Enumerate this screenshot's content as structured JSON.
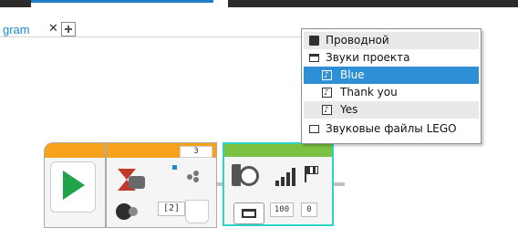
{
  "program_tab": {
    "label": "gram"
  },
  "menu": {
    "items": [
      {
        "label": "Проводной",
        "icon": "block-icon"
      },
      {
        "label": "Звуки проекта",
        "icon": "folder-open-icon"
      },
      {
        "label": "Blue",
        "icon": "sound-file-icon",
        "selected": true
      },
      {
        "label": "Thank you",
        "icon": "sound-file-icon"
      },
      {
        "label": "Yes",
        "icon": "sound-file-icon"
      },
      {
        "label": "Звуковые файлы LEGO",
        "icon": "folder-icon"
      }
    ]
  },
  "blocks": {
    "wait": {
      "count": "3",
      "port": "[2]"
    },
    "sound": {
      "volume": "100",
      "play_type": "0"
    }
  },
  "colors": {
    "accent": "#1b8ad3",
    "selection": "#2f8fd6",
    "start_block": "#f6a21d",
    "sound_block_top": "#7cc242",
    "selected_block_border": "#2bd4c6",
    "play": "#21a34a"
  }
}
